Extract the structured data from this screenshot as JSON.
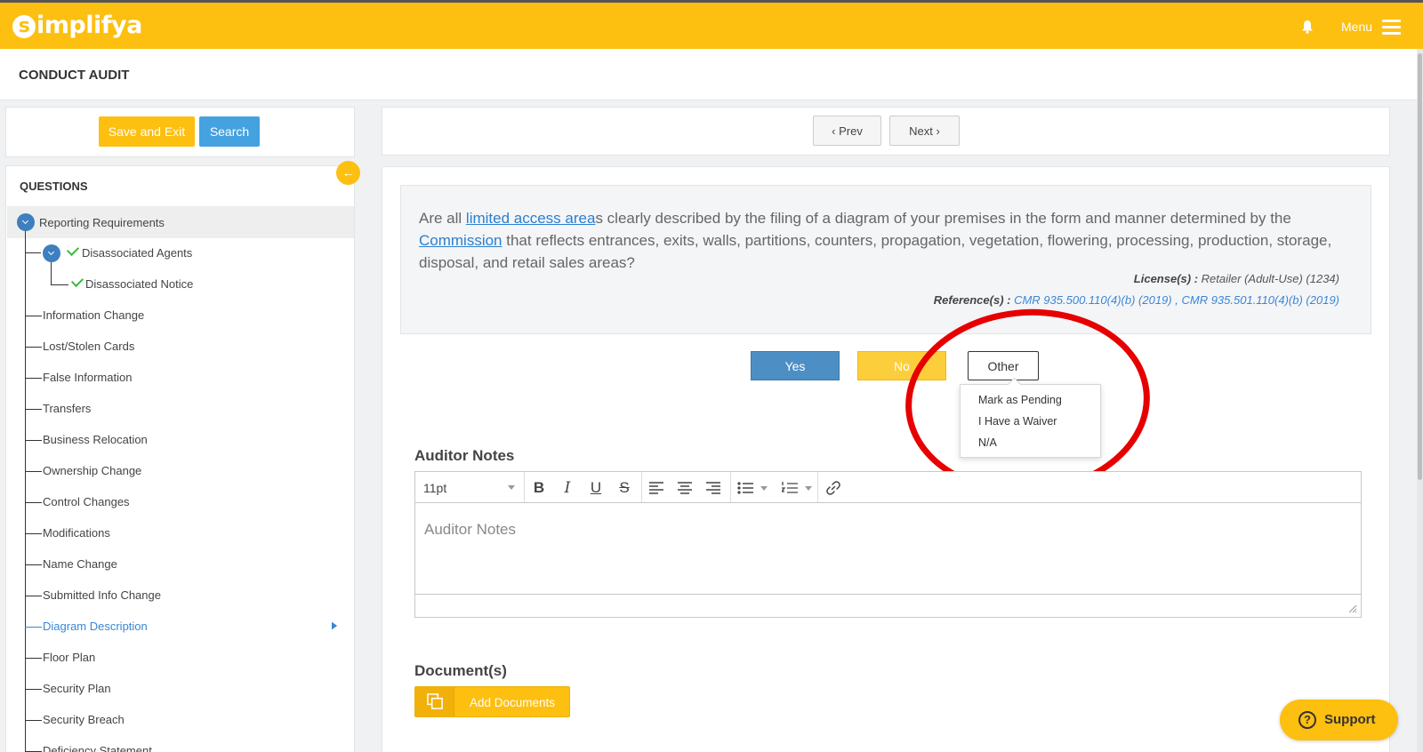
{
  "brand": {
    "logo_initial": "s",
    "logo_rest": "implifya",
    "accent": "#fdbf10"
  },
  "header": {
    "menu_label": "Menu",
    "bell_icon": "bell-icon",
    "menu_icon": "hamburger-icon"
  },
  "page": {
    "title": "CONDUCT AUDIT"
  },
  "left": {
    "save_exit_label": "Save and Exit",
    "search_label": "Search",
    "questions_heading": "QUESTIONS",
    "collapse_glyph": "←",
    "tree": {
      "root": "Reporting Requirements",
      "child": "Disassociated Agents",
      "grandchild": "Disassociated Notice",
      "items": [
        "Information Change",
        "Lost/Stolen Cards",
        "False Information",
        "Transfers",
        "Business Relocation",
        "Ownership Change",
        "Control Changes",
        "Modifications",
        "Name Change",
        "Submitted Info Change",
        "Diagram Description",
        "Floor Plan",
        "Security Plan",
        "Security Breach",
        "Deficiency Statement"
      ],
      "active_item": "Diagram Description"
    }
  },
  "nav": {
    "prev_label": "‹ Prev",
    "next_label": "Next ›"
  },
  "question": {
    "part1": "Are all ",
    "link1": "limited access area",
    "part2": "s clearly described by the filing of a diagram of your premises in the form and manner determined by the ",
    "link2": "Commission",
    "part3": " that reflects entrances, exits, walls, partitions, counters, propagation, vegetation, flowering, processing, production, storage, disposal, and retail sales areas?",
    "license_label": "License(s) :",
    "license_value": "Retailer (Adult-Use) (1234)",
    "reference_label": "Reference(s) :",
    "reference_1": "CMR 935.500.110(4)(b) (2019)",
    "reference_sep": ",",
    "reference_2": "CMR 935.501.110(4)(b) (2019)"
  },
  "answers": {
    "yes_label": "Yes",
    "no_label": "No",
    "other_label": "Other",
    "other_options": [
      "Mark as Pending",
      "I Have a Waiver",
      "N/A"
    ]
  },
  "notes": {
    "label": "Auditor Notes",
    "font_size": "11pt",
    "placeholder": "Auditor Notes"
  },
  "documents": {
    "label": "Document(s)",
    "add_label": "Add Documents"
  },
  "support": {
    "label": "Support",
    "glyph": "?"
  }
}
